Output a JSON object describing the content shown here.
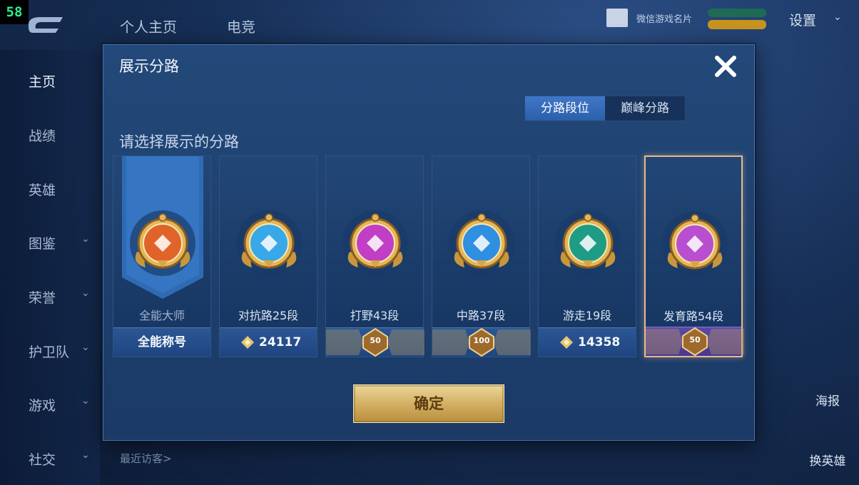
{
  "fps_counter": "58",
  "background": {
    "top_tabs": [
      "个人主页",
      "电竞"
    ],
    "nav_items": [
      {
        "label": "主页",
        "has_chevron": false,
        "active": true
      },
      {
        "label": "战绩",
        "has_chevron": false,
        "active": false
      },
      {
        "label": "英雄",
        "has_chevron": false,
        "active": false
      },
      {
        "label": "图鉴",
        "has_chevron": true,
        "active": false
      },
      {
        "label": "荣誉",
        "has_chevron": true,
        "active": false
      },
      {
        "label": "护卫队",
        "has_chevron": true,
        "active": false
      },
      {
        "label": "游戏",
        "has_chevron": true,
        "active": false
      },
      {
        "label": "社交",
        "has_chevron": true,
        "active": false
      }
    ],
    "chevron_glyph": "⌄",
    "wechat_card_label": "微信游戏名片",
    "settings_label": "设置",
    "right_side": [
      "海报",
      "换英雄"
    ],
    "recent_visitors": "最近访客>"
  },
  "dialog": {
    "title": "展示分路",
    "close_glyph": "✕",
    "toggle": {
      "active": "分路段位",
      "inactive": "巅峰分路"
    },
    "prompt": "请选择展示的分路",
    "cards": [
      {
        "name": "全能大师",
        "footer_type": "text",
        "footer": "全能称号",
        "emblem_color": "#e0642a",
        "selected": false
      },
      {
        "name": "对抗路25段",
        "footer_type": "score",
        "footer": "24117",
        "emblem_color": "#38a8e8",
        "selected": false
      },
      {
        "name": "打野43段",
        "footer_type": "rank",
        "footer": "50",
        "emblem_color": "#c13fc4",
        "selected": false
      },
      {
        "name": "中路37段",
        "footer_type": "rank",
        "footer": "100",
        "emblem_color": "#2f8fe0",
        "selected": false
      },
      {
        "name": "游走19段",
        "footer_type": "score",
        "footer": "14358",
        "emblem_color": "#1f9c86",
        "selected": false
      },
      {
        "name": "发育路54段",
        "footer_type": "rank",
        "footer": "50",
        "emblem_color": "#b84fd0",
        "selected": true
      }
    ],
    "confirm_label": "确定"
  }
}
